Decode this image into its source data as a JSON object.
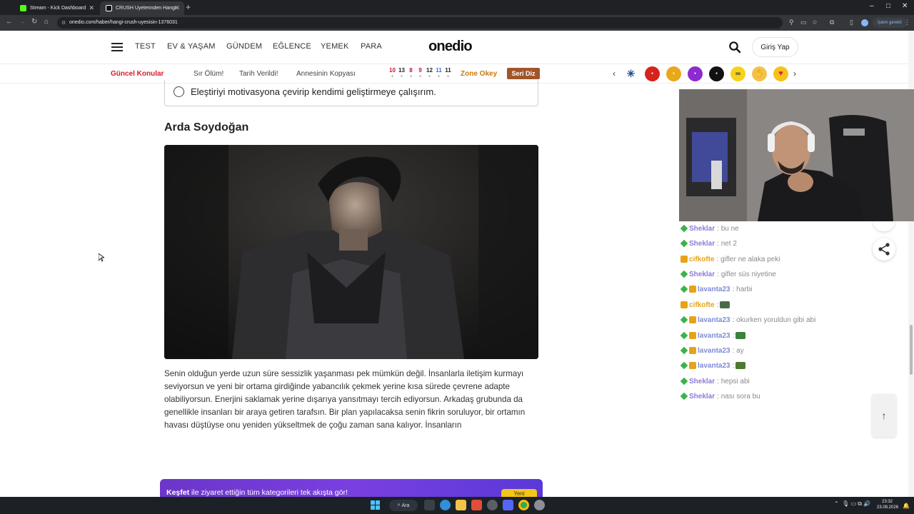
{
  "browser": {
    "tabs": [
      {
        "label": "Stream - Kick Dashboard",
        "active": false,
        "favicon_color": "#53fc18"
      },
      {
        "label": "CRUSH Üyelerinden Hangisi Se...",
        "active": true,
        "favicon_color": "#ffffff"
      }
    ],
    "url": "onedio.com/haber/hangi-crush-uyesisin-1376031",
    "process_label": "İşlem gerekli"
  },
  "site": {
    "logo": "onedio",
    "nav": [
      "TEST",
      "EV & YAŞAM",
      "GÜNDEM",
      "EĞLENCE",
      "YEMEK",
      "PARA"
    ],
    "login_label": "Giriş Yap",
    "topics_label": "Güncel Konular",
    "topics": [
      "Sır Ölüm!",
      "Tarih Verildi!",
      "Annesinin Kopyası"
    ],
    "scores": [
      {
        "top": "10",
        "color": "#c8102e"
      },
      {
        "top": "13",
        "color": "#222222"
      },
      {
        "top": "8",
        "color": "#c8102e"
      },
      {
        "top": "9",
        "color": "#c8102e"
      },
      {
        "top": "12",
        "color": "#222222"
      },
      {
        "top": "11",
        "color": "#3b6fd6"
      },
      {
        "top": "11",
        "color": "#222222"
      }
    ],
    "zone_label": "Zone Okey",
    "seri_label": "Seri Diz",
    "carousel": {
      "prev": "‹",
      "next": "›"
    }
  },
  "article": {
    "option_text": "Eleştiriyi motivasyona çevirip kendimi geliştirmeye çalışırım.",
    "result_title": "Arda Soydoğan",
    "result_text": "Senin olduğun yerde uzun süre sessizlik yaşanması pek mümkün değil. İnsanlarla iletişim kurmayı seviyorsun ve yeni bir ortama girdiğinde yabancılık çekmek yerine kısa sürede çevrene adapte olabiliyorsun. Enerjini saklamak yerine dışarıya yansıtmayı tercih ediyorsun. Arkadaş grubunda da genellikle insanları bir araya getiren tarafsın. Bir plan yapılacaksa senin fikrin soruluyor, bir ortamın havası düştüyse onu yeniden yükseltmek de çoğu zaman sana kalıyor. İnsanların",
    "discover_bold": "Keşfet",
    "discover_text": " ile ziyaret ettiğin tüm kategorileri tek akışta gör!",
    "discover_button": "Yeni"
  },
  "chat": [
    {
      "user": "Sheklar",
      "msg": "bu ne",
      "color": "#8f7bd8",
      "badges": [
        "green"
      ]
    },
    {
      "user": "Sheklar",
      "msg": "net 2",
      "color": "#8f7bd8",
      "badges": [
        "green"
      ]
    },
    {
      "user": "cifkofte",
      "msg": "gifler ne alaka peki",
      "color": "#e6a317",
      "badges": [
        "gold"
      ]
    },
    {
      "user": "Sheklar",
      "msg": "gifler süs niyetine",
      "color": "#8f7bd8",
      "badges": [
        "green"
      ]
    },
    {
      "user": "lavanta23",
      "msg": "harbi",
      "color": "#7f8bd6",
      "badges": [
        "green",
        "gold"
      ]
    },
    {
      "user": "cifkofte",
      "msg": "",
      "color": "#e6a317",
      "badges": [
        "gold"
      ],
      "emote": "#4a6b4a"
    },
    {
      "user": "lavanta23",
      "msg": "okurken yoruldun gibi abi",
      "color": "#7f8bd6",
      "badges": [
        "green",
        "gold"
      ]
    },
    {
      "user": "lavanta23",
      "msg": "",
      "color": "#7f8bd6",
      "badges": [
        "green",
        "gold"
      ],
      "emote": "#3f7f3f"
    },
    {
      "user": "lavanta23",
      "msg": "ay",
      "color": "#7f8bd6",
      "badges": [
        "green",
        "gold"
      ]
    },
    {
      "user": "lavanta23",
      "msg": "",
      "color": "#7f8bd6",
      "badges": [
        "green",
        "gold"
      ],
      "emote": "#4d7a2f"
    },
    {
      "user": "Sheklar",
      "msg": "hepsi abi",
      "color": "#8f7bd8",
      "badges": [
        "green"
      ]
    },
    {
      "user": "Sheklar",
      "msg": "nası sora bu",
      "color": "#8f7bd8",
      "badges": [
        "green"
      ]
    }
  ],
  "taskbar": {
    "search_label": "Ara",
    "time": "23:32",
    "date": "23.08.2026"
  },
  "colors": {
    "accent_red": "#d91a2a",
    "zone": "#c77a0a",
    "seri": "#a0552b",
    "discover": "#6b36c9"
  }
}
